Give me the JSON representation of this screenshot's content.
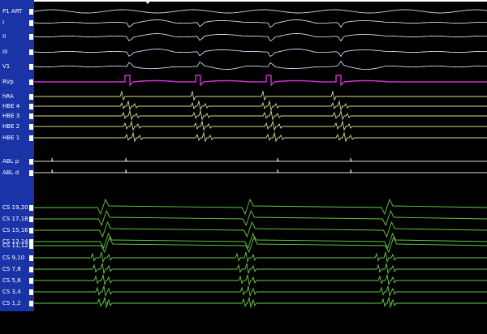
{
  "colors": {
    "panel": "#1a33a6",
    "surface_ecg": "#c8d8f0",
    "pacing": "#cc33cc",
    "intracardiac": "#d8d890",
    "ablation": "#e0e0e0",
    "coronary_sinus": "#66cc44"
  },
  "icons": {
    "scroll_marker": "caret-down-icon",
    "channel_handle": "channel-handle-icon"
  },
  "channels": [
    {
      "label": "P1 ART",
      "group": "surface"
    },
    {
      "label": "I",
      "group": "surface"
    },
    {
      "label": "II",
      "group": "surface"
    },
    {
      "label": "III",
      "group": "surface"
    },
    {
      "label": "V1",
      "group": "surface"
    },
    {
      "label": "RVp",
      "group": "pacing"
    },
    {
      "label": "hRA",
      "group": "intracardiac"
    },
    {
      "label": "HBE 4",
      "group": "intracardiac"
    },
    {
      "label": "HBE 3",
      "group": "intracardiac"
    },
    {
      "label": "HBE 2",
      "group": "intracardiac"
    },
    {
      "label": "HBE 1",
      "group": "intracardiac"
    },
    {
      "label": "ABL p",
      "group": "ablation"
    },
    {
      "label": "ABL d",
      "group": "ablation"
    },
    {
      "label": "CS 19,20",
      "group": "cs"
    },
    {
      "label": "CS 17,18",
      "group": "cs"
    },
    {
      "label": "CS 15,16",
      "group": "cs"
    },
    {
      "label": "CS 13,14",
      "group": "cs"
    },
    {
      "label": "CS 11,12",
      "group": "cs"
    },
    {
      "label": "CS 9,10",
      "group": "cs"
    },
    {
      "label": "CS 7,8",
      "group": "cs"
    },
    {
      "label": "CS 5,6",
      "group": "cs"
    },
    {
      "label": "CS 3,4",
      "group": "cs"
    },
    {
      "label": "CS 1,2",
      "group": "cs"
    }
  ]
}
